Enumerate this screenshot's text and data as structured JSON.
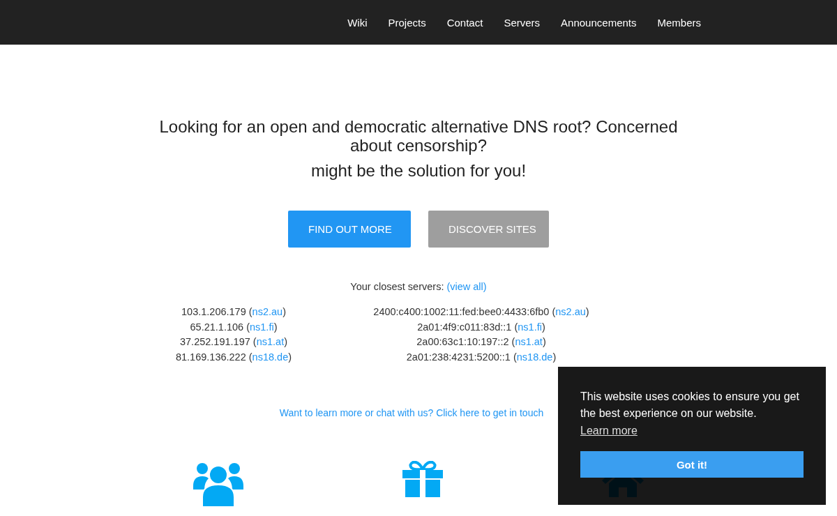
{
  "nav": {
    "items": [
      "Wiki",
      "Projects",
      "Contact",
      "Servers",
      "Announcements",
      "Members"
    ]
  },
  "hero": {
    "heading": "Looking for an open and democratic alternative DNS root? Concerned about censorship?",
    "subheading": "might be the solution for you!"
  },
  "buttons": [
    {
      "label": "FIND OUT MORE",
      "kind": "primary"
    },
    {
      "label": "DISCOVER SITES",
      "kind": "secondary"
    }
  ],
  "servers": {
    "label": "Your closest servers:",
    "view_all": "(view all)",
    "ipv4": [
      {
        "address": "103.1.206.179",
        "open": "(",
        "host": "ns2.au",
        "close": ")"
      },
      {
        "address": "65.21.1.106",
        "open": "(",
        "host": "ns1.fi",
        "close": ")"
      },
      {
        "address": "37.252.191.197",
        "open": "(",
        "host": "ns1.at",
        "close": ")"
      },
      {
        "address": "81.169.136.222",
        "open": "(",
        "host": "ns18.de",
        "close": ")"
      }
    ],
    "ipv6": [
      {
        "address": "2400:c400:1002:11:fed:bee0:4433:6fb0",
        "open": "(",
        "host": "ns2.au",
        "close": ")"
      },
      {
        "address": "2a01:4f9:c011:83d::1",
        "open": "(",
        "host": "ns1.fi",
        "close": ")"
      },
      {
        "address": "2a00:63c1:10:197::2",
        "open": "(",
        "host": "ns1.at",
        "close": ")"
      },
      {
        "address": "2a01:238:4231:5200::1",
        "open": "(",
        "host": "ns18.de",
        "close": ")"
      }
    ]
  },
  "contact_link": "Want to learn more or chat with us? Click here to get in touch",
  "cookie_banner": {
    "message": "This website uses cookies to ensure you get the best experience on our website.",
    "learn_more": "Learn more",
    "accept": "Got it!"
  }
}
